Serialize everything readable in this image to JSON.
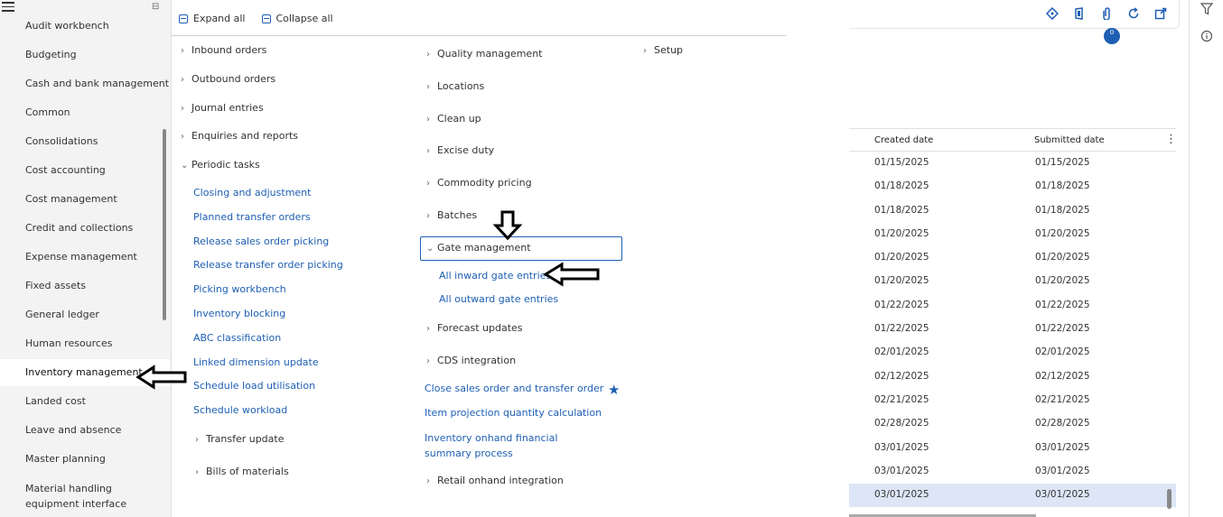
{
  "left_nav": {
    "items": [
      {
        "label": "Audit workbench"
      },
      {
        "label": "Budgeting"
      },
      {
        "label": "Cash and bank management"
      },
      {
        "label": "Common"
      },
      {
        "label": "Consolidations"
      },
      {
        "label": "Cost accounting"
      },
      {
        "label": "Cost management"
      },
      {
        "label": "Credit and collections"
      },
      {
        "label": "Expense management"
      },
      {
        "label": "Fixed assets"
      },
      {
        "label": "General ledger"
      },
      {
        "label": "Human resources"
      },
      {
        "label": "Inventory management"
      },
      {
        "label": "Landed cost"
      },
      {
        "label": "Leave and absence"
      },
      {
        "label": "Master planning"
      },
      {
        "label": "Material handling equipment interface"
      }
    ],
    "active_index": 12
  },
  "menu": {
    "expand_all": "Expand all",
    "collapse_all": "Collapse all",
    "col1": {
      "inbound_orders": "Inbound orders",
      "outbound_orders": "Outbound orders",
      "journal_entries": "Journal entries",
      "enquiries_reports": "Enquiries and reports",
      "periodic_tasks": "Periodic tasks",
      "periodic_links": [
        "Closing and adjustment",
        "Planned transfer orders",
        "Release sales order picking",
        "Release transfer order picking",
        "Picking workbench",
        "Inventory blocking",
        "ABC classification",
        "Linked dimension update",
        "Schedule load utilisation",
        "Schedule workload"
      ],
      "transfer_update": "Transfer update",
      "bills_of_materials": "Bills of materials"
    },
    "col2": {
      "quality_management": "Quality management",
      "locations": "Locations",
      "clean_up": "Clean up",
      "excise_duty": "Excise duty",
      "commodity_pricing": "Commodity pricing",
      "batches": "Batches",
      "gate_management": "Gate management",
      "all_inward": "All inward gate entries",
      "all_outward": "All outward gate entries",
      "forecast_updates": "Forecast updates",
      "cds_integration": "CDS integration",
      "close_sales_order": "Close sales order and transfer order",
      "item_projection": "Item projection quantity calculation",
      "inventory_onhand": "Inventory onhand financial summary process",
      "retail_onhand": "Retail onhand integration"
    },
    "col3": {
      "setup": "Setup"
    }
  },
  "background": {
    "badge_count": "0",
    "columns": [
      "Created date",
      "Submitted date"
    ],
    "rows": [
      [
        "01/15/2025",
        "01/15/2025"
      ],
      [
        "01/18/2025",
        "01/18/2025"
      ],
      [
        "01/18/2025",
        "01/18/2025"
      ],
      [
        "01/20/2025",
        "01/20/2025"
      ],
      [
        "01/20/2025",
        "01/20/2025"
      ],
      [
        "01/20/2025",
        "01/20/2025"
      ],
      [
        "01/22/2025",
        "01/22/2025"
      ],
      [
        "01/22/2025",
        "01/22/2025"
      ],
      [
        "02/01/2025",
        "02/01/2025"
      ],
      [
        "02/12/2025",
        "02/12/2025"
      ],
      [
        "02/21/2025",
        "02/21/2025"
      ],
      [
        "02/28/2025",
        "02/28/2025"
      ],
      [
        "03/01/2025",
        "03/01/2025"
      ],
      [
        "03/01/2025",
        "03/01/2025"
      ],
      [
        "03/01/2025",
        "03/01/2025"
      ]
    ],
    "selected_row": 14
  },
  "colors": {
    "accent": "#1e5fb3",
    "selected_row": "#dde6f7"
  }
}
